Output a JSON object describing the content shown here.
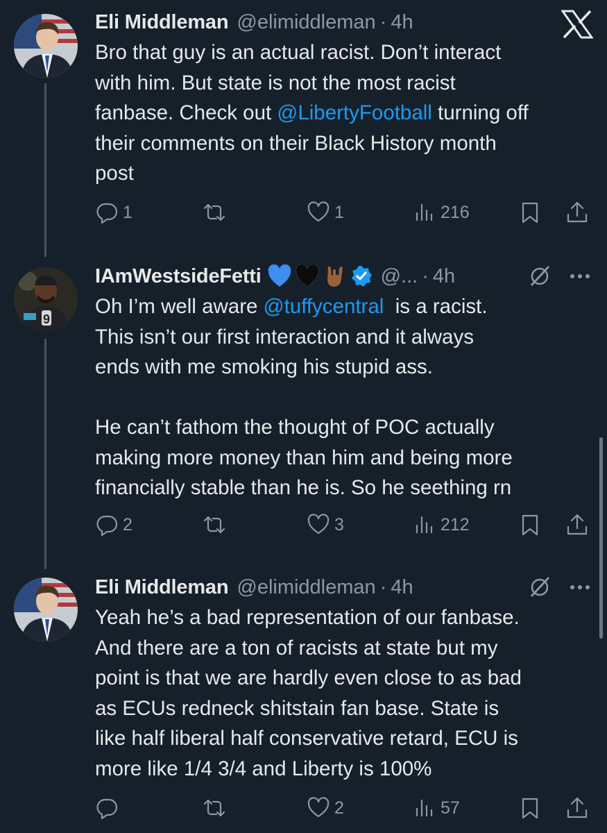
{
  "tweets": [
    {
      "name": "Eli Middleman",
      "handle": "@elimiddleman",
      "time": "4h",
      "text_parts": [
        "Bro that guy is an actual racist. Don’t interact\nwith him. But state is not the most racist\nfanbase. Check out ",
        "@LibertyFootball",
        " turning off\ntheir comments on their Black History month\npost"
      ],
      "replies": "1",
      "retweets": "",
      "likes": "1",
      "views": "216"
    },
    {
      "name": "IAmWestsideFetti",
      "handle": "@...",
      "time": "4h",
      "text_parts": [
        "Oh I’m well aware ",
        "@tuffycentral",
        "  is a racist.\nThis isn’t our first interaction and it always\nends with me smoking his stupid ass.\n\nHe can’t fathom the thought of POC actually\nmaking more money than him and being more\nfinancially stable than he is. So he seething rn"
      ],
      "replies": "2",
      "retweets": "",
      "likes": "3",
      "views": "212"
    },
    {
      "name": "Eli Middleman",
      "handle": "@elimiddleman",
      "time": "4h",
      "text_parts": [
        "Yeah he’s a bad representation of our fanbase.\nAnd there are a ton of racists at state but my\npoint is that we are hardly even close to as bad\nas ECUs redneck shitstain fan base. State is\nlike half liberal half conservative retard, ECU is\nmore like 1/4 3/4 and Liberty is 100%"
      ],
      "replies": "",
      "retweets": "",
      "likes": "2",
      "views": "57"
    }
  ],
  "icons": {
    "app_logo": "x-logo-icon",
    "verified": "verified-badge-icon",
    "grok": "grok-icon",
    "more": "more-options-icon",
    "reply": "reply-icon",
    "retweet": "retweet-icon",
    "like": "heart-icon",
    "views": "views-icon",
    "bookmark": "bookmark-icon",
    "share": "share-icon"
  },
  "colors": {
    "background": "#15202b",
    "text": "#e7e9ea",
    "secondary": "#8b98a5",
    "link": "#1d9bf0"
  }
}
